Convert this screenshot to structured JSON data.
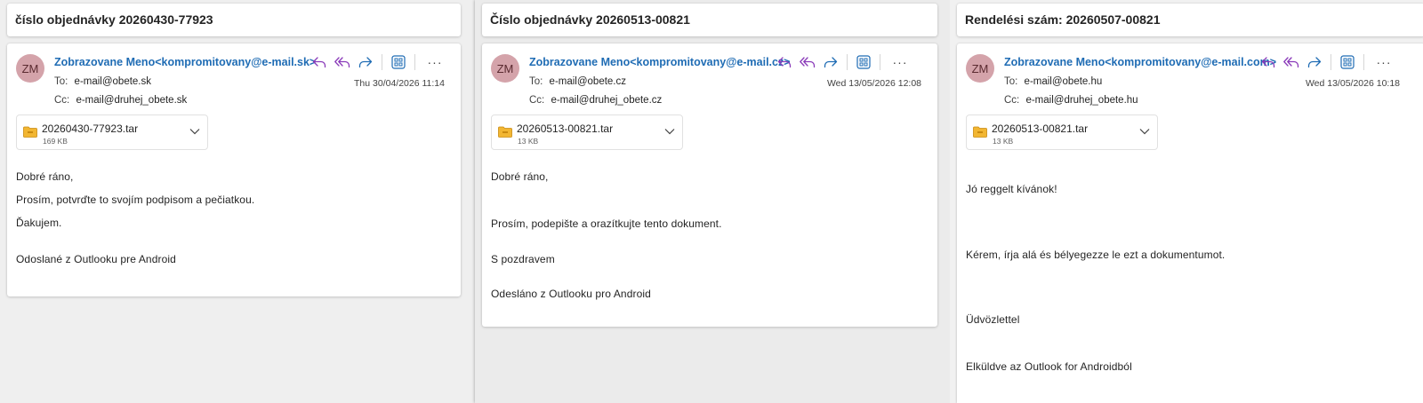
{
  "colors": {
    "sender": "#1f6cb4",
    "avatar_bg": "#d4a3aa",
    "reply_purple": "#8a3ab9",
    "apps_blue": "#1f6cb4"
  },
  "icons": [
    "reply-icon",
    "reply-all-icon",
    "forward-icon",
    "apps-icon",
    "more-icon",
    "folder-icon",
    "chevron-down-icon"
  ],
  "panes": [
    {
      "subject": "číslo objednávky 20260430-77923",
      "avatar": "ZM",
      "sender": "Zobrazovane Meno<kompromitovany@e-mail.sk>",
      "to_label": "To:",
      "to": "e-mail@obete.sk",
      "cc_label": "Cc:",
      "cc": "e-mail@druhej_obete.sk",
      "date": "Thu 30/04/2026 11:14",
      "attachment": {
        "name": "20260430-77923.tar",
        "size": "169 KB"
      },
      "body": [
        "Dobré ráno,",
        "Prosím, potvrďte to svojím podpisom a pečiatkou.",
        "Ďakujem.",
        "Odoslané z Outlooku pre Android"
      ]
    },
    {
      "subject": "Číslo objednávky 20260513-00821",
      "avatar": "ZM",
      "sender": "Zobrazovane Meno<kompromitovany@e-mail.cz>",
      "to_label": "To:",
      "to": "e-mail@obete.cz",
      "cc_label": "Cc:",
      "cc": "e-mail@druhej_obete.cz",
      "date": "Wed 13/05/2026 12:08",
      "attachment": {
        "name": "20260513-00821.tar",
        "size": "13 KB"
      },
      "body": [
        "Dobré ráno,",
        "Prosím, podepište a orazítkujte tento dokument.",
        "S pozdravem",
        "Odesláno z Outlooku pro Android"
      ]
    },
    {
      "subject": "Rendelési szám: 20260507-00821",
      "avatar": "ZM",
      "sender": "Zobrazovane Meno<kompromitovany@e-mail.com>",
      "to_label": "To:",
      "to": "e-mail@obete.hu",
      "cc_label": "Cc:",
      "cc": "e-mail@druhej_obete.hu",
      "date": "Wed 13/05/2026 10:18",
      "attachment": {
        "name": "20260513-00821.tar",
        "size": "13 KB"
      },
      "body": [
        "Jó reggelt kívánok!",
        "Kérem, írja alá és bélyegezze le ezt a dokumentumot.",
        "Üdvözlettel",
        "Elküldve az Outlook for Androidból"
      ]
    }
  ]
}
